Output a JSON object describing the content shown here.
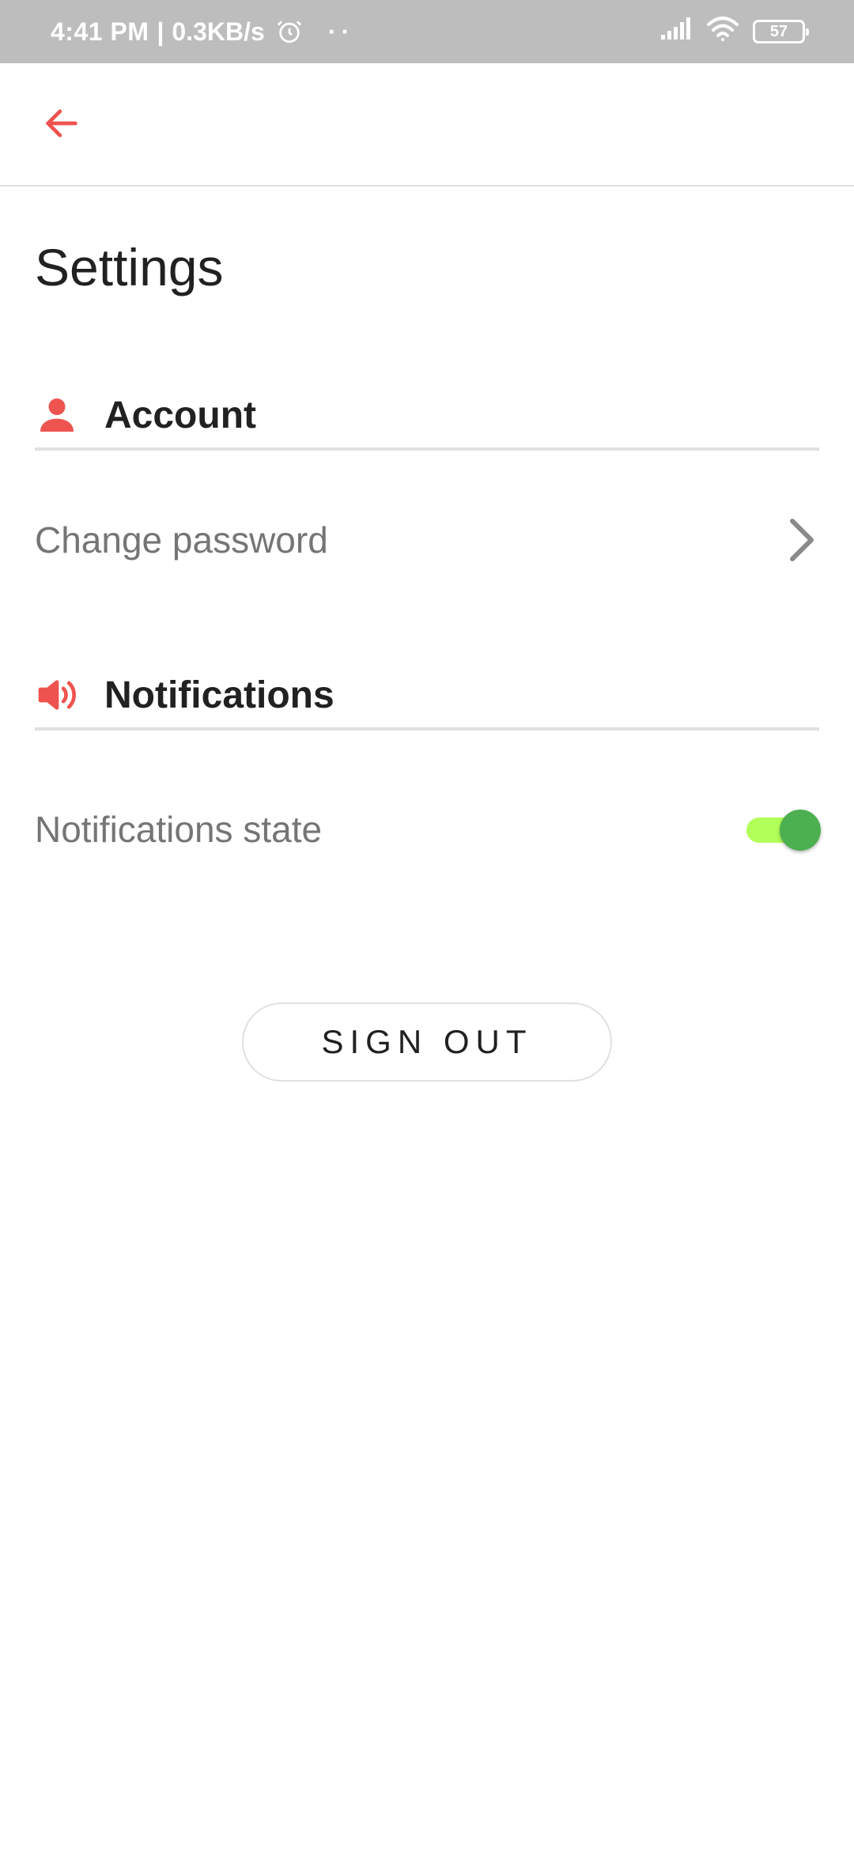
{
  "status_bar": {
    "time": "4:41 PM",
    "separator": "|",
    "network_speed": "0.3KB/s",
    "dots": "··",
    "battery_level": "57",
    "icons": [
      "alarm-icon",
      "signal-icon",
      "wifi-icon",
      "battery-icon"
    ]
  },
  "app_bar": {
    "back_icon": "arrow-back-icon"
  },
  "page": {
    "title": "Settings"
  },
  "sections": {
    "account": {
      "label": "Account",
      "icon": "person-icon",
      "items": {
        "change_password": {
          "label": "Change password",
          "trail_icon": "chevron-right-icon"
        }
      }
    },
    "notifications": {
      "label": "Notifications",
      "icon": "speaker-icon",
      "items": {
        "state": {
          "label": "Notifications state",
          "enabled": true
        }
      }
    }
  },
  "actions": {
    "sign_out_label": "SIGN OUT"
  },
  "colors": {
    "accent": "#ef5350",
    "status_bar": "#bdbdbd",
    "toggle_track": "#b2ff59",
    "toggle_thumb": "#4caf50",
    "divider": "#e0e0e0",
    "secondary_text": "#757575",
    "primary_text": "#212121"
  }
}
